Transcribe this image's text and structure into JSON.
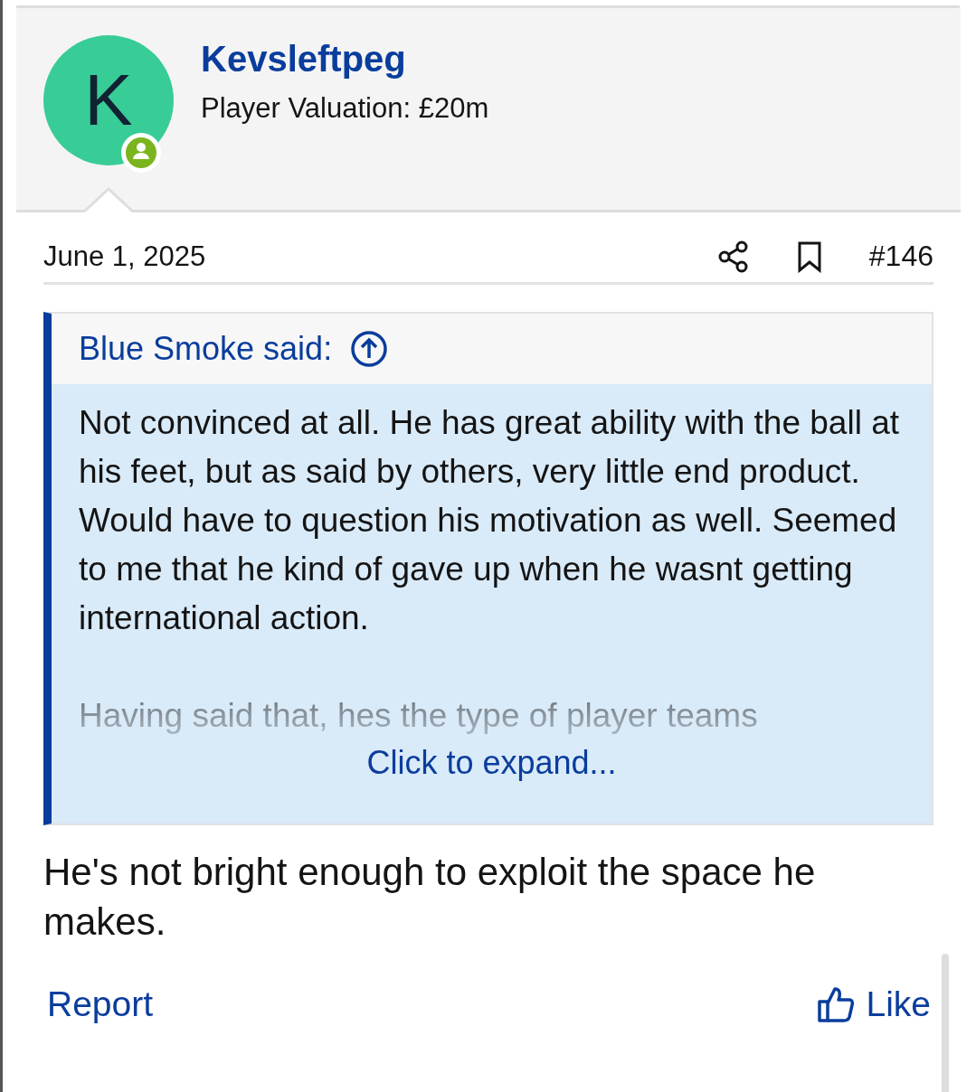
{
  "author": {
    "avatar_letter": "K",
    "name": "Kevsleftpeg",
    "title": "Player Valuation: £20m"
  },
  "post": {
    "date": "June 1, 2025",
    "number": "#146"
  },
  "quote": {
    "attribution": "Blue Smoke said:",
    "paragraphs": [
      {
        "lines": [
          "Not convinced at all. He has great ability with the ball at his feet, but as said by others, very little end product.",
          "Would have to question his motivation as well. Seemed to me that he kind of gave up when he wasnt getting international action."
        ]
      },
      {
        "lines": [
          "Having said that, hes the type of player teams"
        ]
      }
    ],
    "expand": "Click to expand..."
  },
  "message": "He's not bright enough to exploit the space he makes.",
  "actions": {
    "report": "Report",
    "like": "Like"
  }
}
